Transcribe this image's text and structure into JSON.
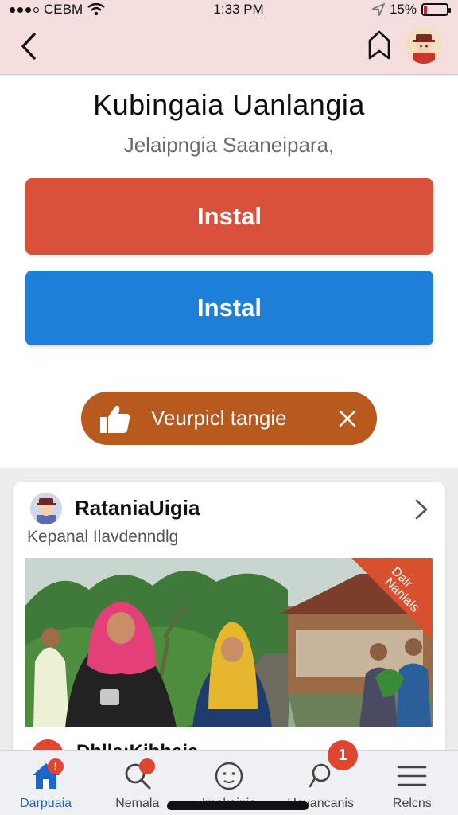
{
  "status_bar": {
    "carrier": "CEBM",
    "time": "1:33 PM",
    "battery_percent": "15%",
    "battery_level": 0.15
  },
  "nav": {
    "back_icon": "chevron-left-icon",
    "bookmark_icon": "bookmark-icon",
    "avatar_icon": "profile-avatar"
  },
  "hero": {
    "title": "Kubingaia Uanlangia",
    "subtitle": "Jelaipngia Saaneipara,",
    "primary_button": "Instal",
    "secondary_button": "Instal",
    "pill_label": "Veurpicl tangie",
    "pill_icon": "thumbs-up-icon",
    "pill_close_icon": "close-icon"
  },
  "post": {
    "author": "RataniaUigia",
    "subtitle": "Kepanal Ilavdenndlg",
    "ribbon": [
      "Dalr",
      "Nanlals"
    ],
    "next_author": "Dhlla:Kihhaia"
  },
  "tabs": [
    {
      "label": "Darpuaia",
      "icon": "home-icon",
      "active": true,
      "dot": true
    },
    {
      "label": "Nemala",
      "icon": "search-icon",
      "active": false,
      "dot": true
    },
    {
      "label": "Imakaipia",
      "icon": "face-icon",
      "active": false,
      "dot": false
    },
    {
      "label": "Havancanis",
      "icon": "chat-icon",
      "active": false,
      "dot": false
    },
    {
      "label": "Relcns",
      "icon": "menu-icon",
      "active": false,
      "dot": false
    }
  ],
  "notification_count": "1",
  "colors": {
    "header_bg": "#f4dede",
    "primary_red": "#d9503b",
    "primary_blue": "#1d7fd8",
    "pill_brown": "#b85a1e",
    "badge_red": "#e0452f",
    "active_blue": "#1b66c9"
  }
}
